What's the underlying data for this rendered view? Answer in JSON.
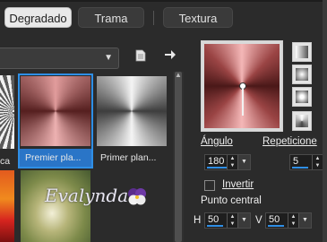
{
  "tabs": [
    {
      "label": "Degradado",
      "active": true
    },
    {
      "label": "Trama",
      "active": false
    },
    {
      "label": "Textura",
      "active": false
    }
  ],
  "toolbar": {
    "copy_icon": "page-icon",
    "export_icon": "right-arrow-icon"
  },
  "gallery": {
    "items": [
      {
        "label": "ca"
      },
      {
        "label": "Premier pla...",
        "selected": true
      },
      {
        "label": "Primer plan..."
      }
    ]
  },
  "preview": {
    "colors": {
      "center": "#ffffff",
      "light": "#f5b3b3",
      "mid": "#c46a6a",
      "dark": "#6e2a2a",
      "outer": "#3e1717"
    }
  },
  "angle": {
    "label": "Ángulo",
    "value": "180"
  },
  "repeat": {
    "label": "Repeticione",
    "value": "5"
  },
  "invert": {
    "label": "Invertir",
    "checked": false
  },
  "center_point": {
    "label": "Punto central",
    "h_label": "H",
    "h_value": "50",
    "v_label": "V",
    "v_value": "50"
  },
  "watermark": {
    "text": "Evalynda"
  },
  "colors": {
    "accent": "#2f8fe6",
    "panel": "#2b2b2b"
  }
}
